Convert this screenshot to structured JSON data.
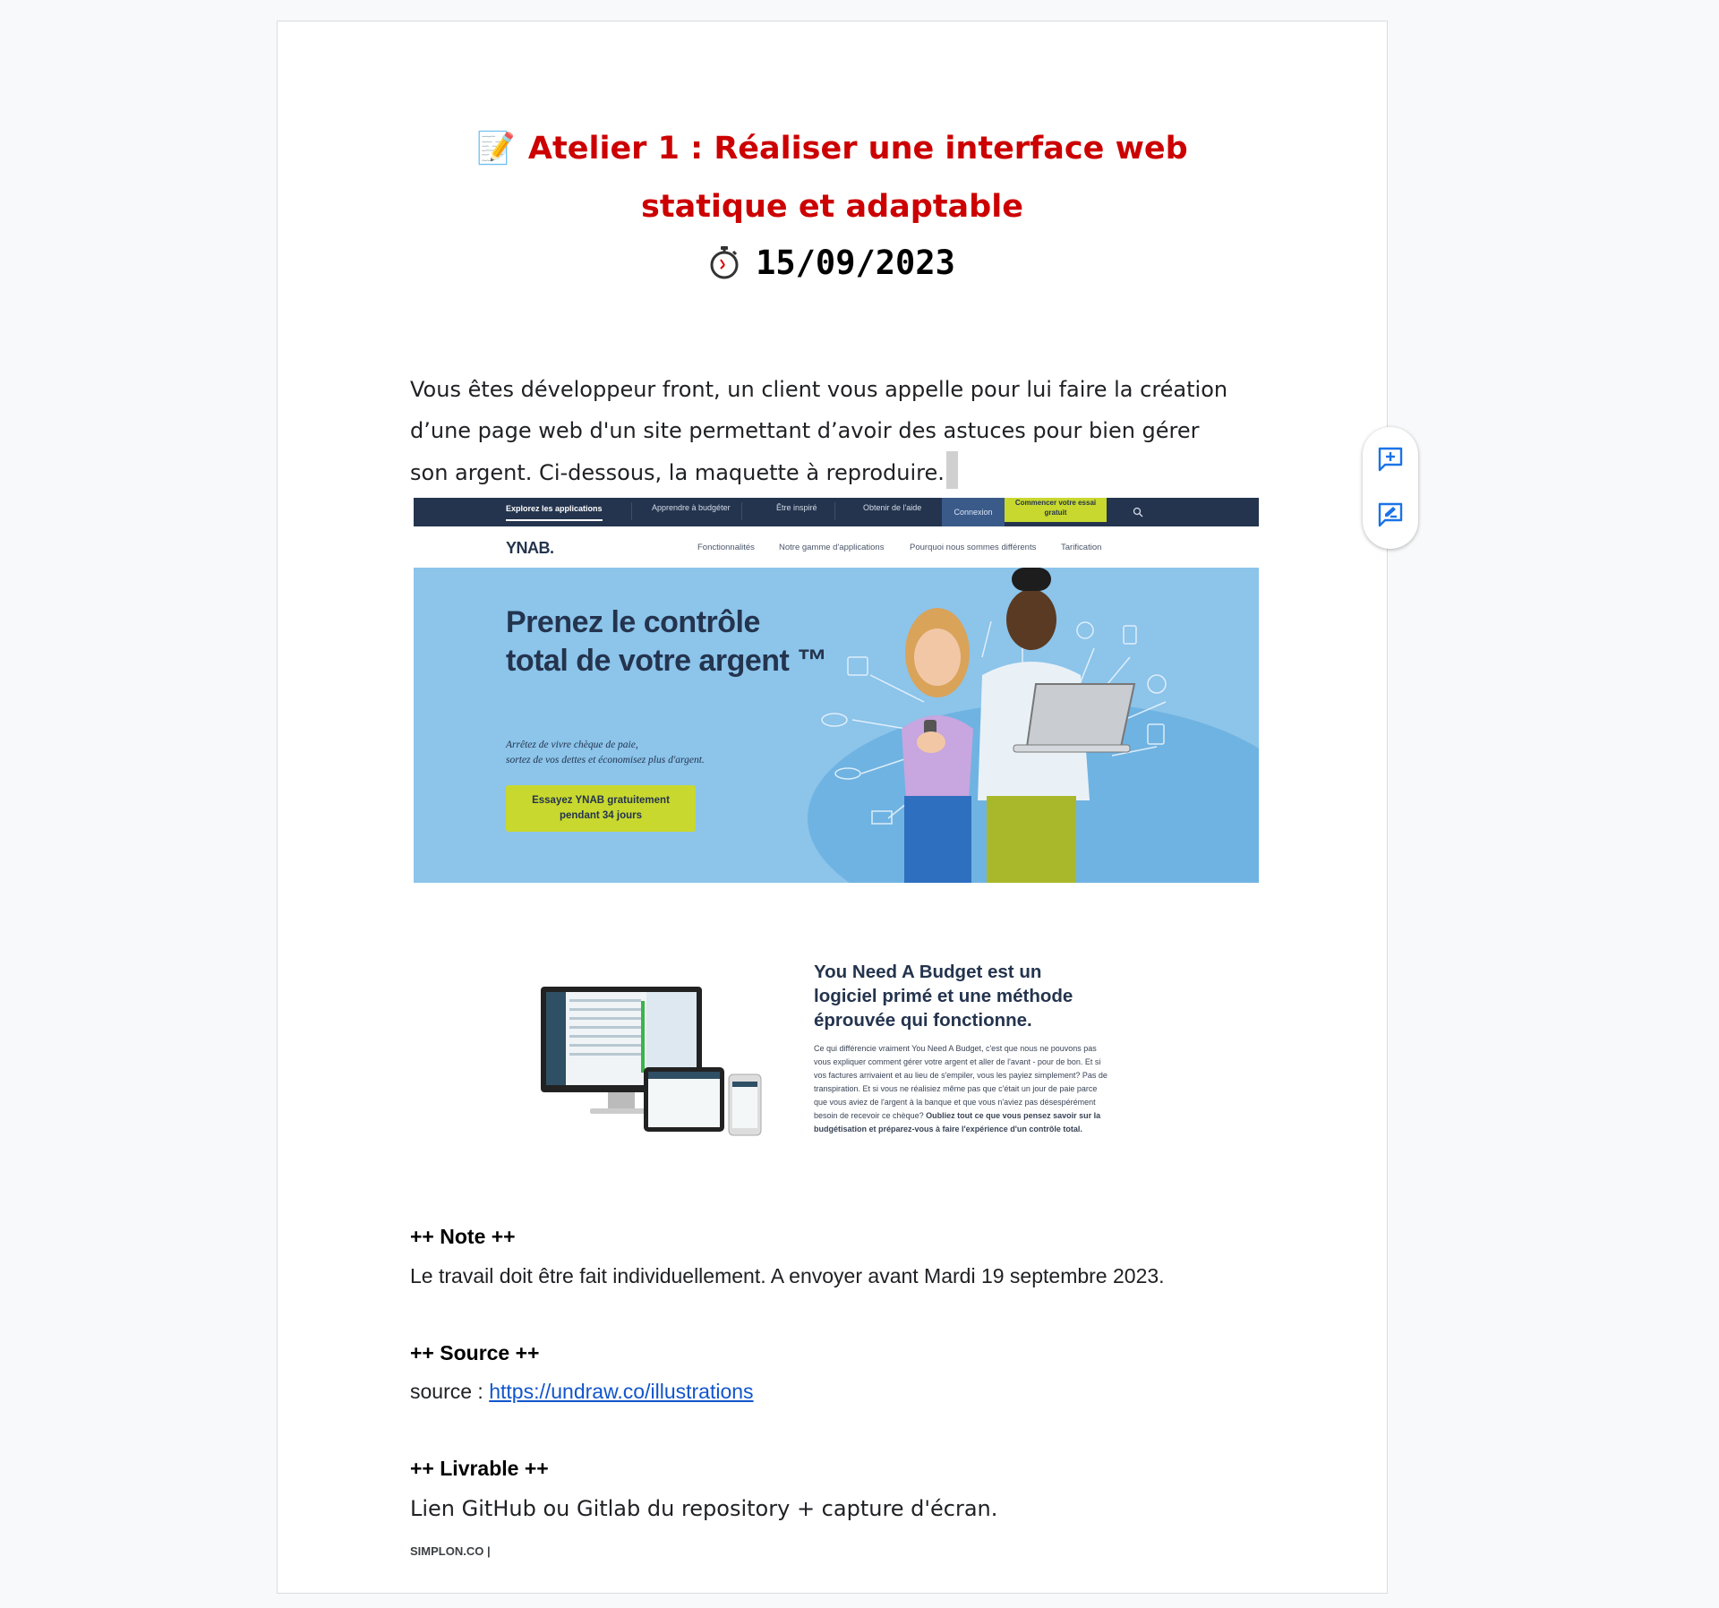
{
  "doc": {
    "title_emoji": "📝",
    "title_line1": "Atelier 1 : Réaliser une interface web",
    "title_line2": "statique et adaptable",
    "date": "15/09/2023",
    "intro": "Vous êtes développeur front, un client vous appelle pour lui faire la création d’une page web d'un site permettant d’avoir des astuces pour bien gérer son argent. Ci-dessous, la maquette à reproduire."
  },
  "mockup": {
    "topnav": [
      "Explorez les applications",
      "Apprendre à budgéter",
      "Être inspiré",
      "Obtenir de l'aide",
      "Connexion",
      "Commencer votre essai gratuit"
    ],
    "logo": "YNAB.",
    "subnav": [
      "Fonctionnalités",
      "Notre gamme d'applications",
      "Pourquoi nous sommes différents",
      "Tarification"
    ],
    "hero_title": "Prenez le contrôle total de votre argent ™",
    "hero_sub_1": "Arrêtez de vivre chèque de paie,",
    "hero_sub_2": "sortez de vos dettes et économisez plus d'argent.",
    "hero_cta_1": "Essayez YNAB gratuitement",
    "hero_cta_2": "pendant 34 jours",
    "section_title": "You Need A Budget est un logiciel primé et une méthode éprouvée qui fonctionne.",
    "section_body": "Ce qui différencie vraiment You Need A Budget, c'est que nous ne pouvons pas vous expliquer comment gérer votre argent et aller de l'avant - pour de bon. Et si vos factures arrivaient et au lieu de s'empiler, vous les payiez simplement? Pas de transpiration. Et si vous ne réalisiez même pas que c'était un jour de paie parce que vous aviez de l'argent à la banque et que vous n'aviez pas désespérément besoin de recevoir ce chèque?",
    "section_body_bold": "Oubliez tout ce que vous pensez savoir sur la budgétisation et préparez-vous à faire l'expérience d'un contrôle total."
  },
  "note": {
    "heading": "++ Note ++",
    "text": "Le travail doit être fait individuellement. A envoyer avant Mardi 19 septembre 2023."
  },
  "source": {
    "heading": "++ Source ++",
    "prefix": "source : ",
    "link": "https://undraw.co/illustrations"
  },
  "livrable": {
    "heading": "++ Livrable ++",
    "text": "Lien GitHub ou Gitlab du repository + capture d'écran."
  },
  "footer": "SIMPLON.CO |",
  "colors": {
    "title": "#cc0000",
    "link": "#1155cc",
    "accent": "#1a73e8"
  },
  "icons": [
    "memo-icon",
    "stopwatch-icon",
    "add-comment-icon",
    "suggest-edit-icon",
    "search-icon"
  ]
}
